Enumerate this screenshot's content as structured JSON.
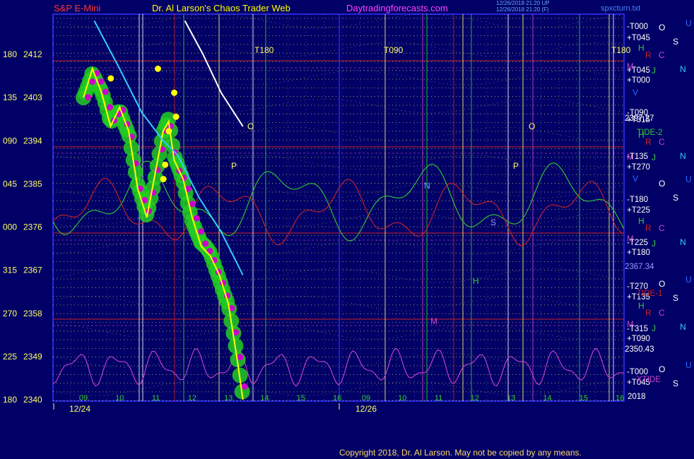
{
  "header": {
    "symbol": "S&P E-Mini",
    "title": "Dr. Al Larson's Chaos Trader Web",
    "site": "Daytradingforecasts.com",
    "stamp1": "12/26/2018 21:20 UP",
    "stamp2": "12/26/2018 21:20 (F)",
    "file": "spxcturn.txt"
  },
  "footer": {
    "copyright": "Copyright 2018, Dr. Al Larson. May not be copied by any means."
  },
  "colors": {
    "background": "#000066",
    "frame": "#3333ff",
    "price_line": "#ffff00",
    "fast_band": "#22cc22",
    "dots_magenta": "#cc00cc",
    "dots_yellow": "#ffff00",
    "cyan_line": "#33ccff",
    "white_line": "#ffffff",
    "tide2": "#33cc33",
    "tide1": "#cc2222",
    "xtide": "#cc44cc"
  },
  "chart_data": {
    "type": "line",
    "title": "S&P E-Mini",
    "ylim": [
      2340,
      2415
    ],
    "y_ticks": [
      {
        "angle": "180",
        "price": "2412"
      },
      {
        "angle": "135",
        "price": "2403"
      },
      {
        "angle": "090",
        "price": "2394"
      },
      {
        "angle": "045",
        "price": "2385"
      },
      {
        "angle": "000",
        "price": "2376"
      },
      {
        "angle": "315",
        "price": "2367"
      },
      {
        "angle": "270",
        "price": "2358"
      },
      {
        "angle": "225",
        "price": "2349"
      },
      {
        "angle": "180",
        "price": "2340"
      }
    ],
    "x_hours": [
      "09",
      "10",
      "11",
      "12",
      "13",
      "14",
      "15",
      "16",
      "09",
      "10",
      "11",
      "12",
      "13",
      "14",
      "15",
      "16"
    ],
    "x_dates": [
      "12/24",
      "12/26"
    ],
    "price_series": [
      {
        "t": 0.0,
        "p": 2403
      },
      {
        "t": 0.25,
        "p": 2409
      },
      {
        "t": 0.5,
        "p": 2404
      },
      {
        "t": 0.75,
        "p": 2397
      },
      {
        "t": 1.0,
        "p": 2401
      },
      {
        "t": 1.25,
        "p": 2396
      },
      {
        "t": 1.5,
        "p": 2384
      },
      {
        "t": 1.75,
        "p": 2378
      },
      {
        "t": 2.0,
        "p": 2388
      },
      {
        "t": 2.2,
        "p": 2396
      },
      {
        "t": 2.35,
        "p": 2398
      },
      {
        "t": 2.5,
        "p": 2390
      },
      {
        "t": 2.75,
        "p": 2386
      },
      {
        "t": 3.0,
        "p": 2378
      },
      {
        "t": 3.25,
        "p": 2372
      },
      {
        "t": 3.5,
        "p": 2370
      },
      {
        "t": 3.75,
        "p": 2366
      },
      {
        "t": 4.0,
        "p": 2360
      },
      {
        "t": 4.25,
        "p": 2348
      },
      {
        "t": 4.4,
        "p": 2340
      }
    ],
    "cyan_series": [
      {
        "t": 0.3,
        "p": 2419
      },
      {
        "t": 1.0,
        "p": 2409
      },
      {
        "t": 1.6,
        "p": 2400
      },
      {
        "t": 2.2,
        "p": 2394
      },
      {
        "t": 2.6,
        "p": 2391
      },
      {
        "t": 3.2,
        "p": 2382
      },
      {
        "t": 3.8,
        "p": 2375
      },
      {
        "t": 4.4,
        "p": 2366
      }
    ],
    "white_series": [
      {
        "t": 2.8,
        "p": 2419
      },
      {
        "t": 3.3,
        "p": 2412
      },
      {
        "t": 3.8,
        "p": 2404
      },
      {
        "t": 4.4,
        "p": 2397
      }
    ],
    "right_levels": [
      {
        "price": "2397.27",
        "label": "TIDE-2"
      },
      {
        "price": "2367.34",
        "label": "TIDE-1"
      },
      {
        "price": "2350.43",
        "label": "XTIDE"
      }
    ],
    "right_labels": [
      "-T000",
      "+T045",
      "M",
      "+T045",
      "+T000",
      "-T090",
      "+T315",
      "M",
      "-T135",
      "+T270",
      "-T180",
      "+T225",
      "M",
      "-T225",
      "+T180",
      "-T270",
      "+T135",
      "M",
      "-T315",
      "+T090",
      "-T000",
      "+T045"
    ],
    "top_labels": [
      "T180",
      "T090",
      "T180"
    ],
    "markers": [
      "O",
      "P",
      "O",
      "P",
      "N",
      "S",
      "H",
      "M"
    ],
    "planet_letters": [
      "O",
      "P",
      "S",
      "U",
      "H",
      "R",
      "C",
      "N",
      "J",
      "V"
    ],
    "corner_value": "2018"
  }
}
